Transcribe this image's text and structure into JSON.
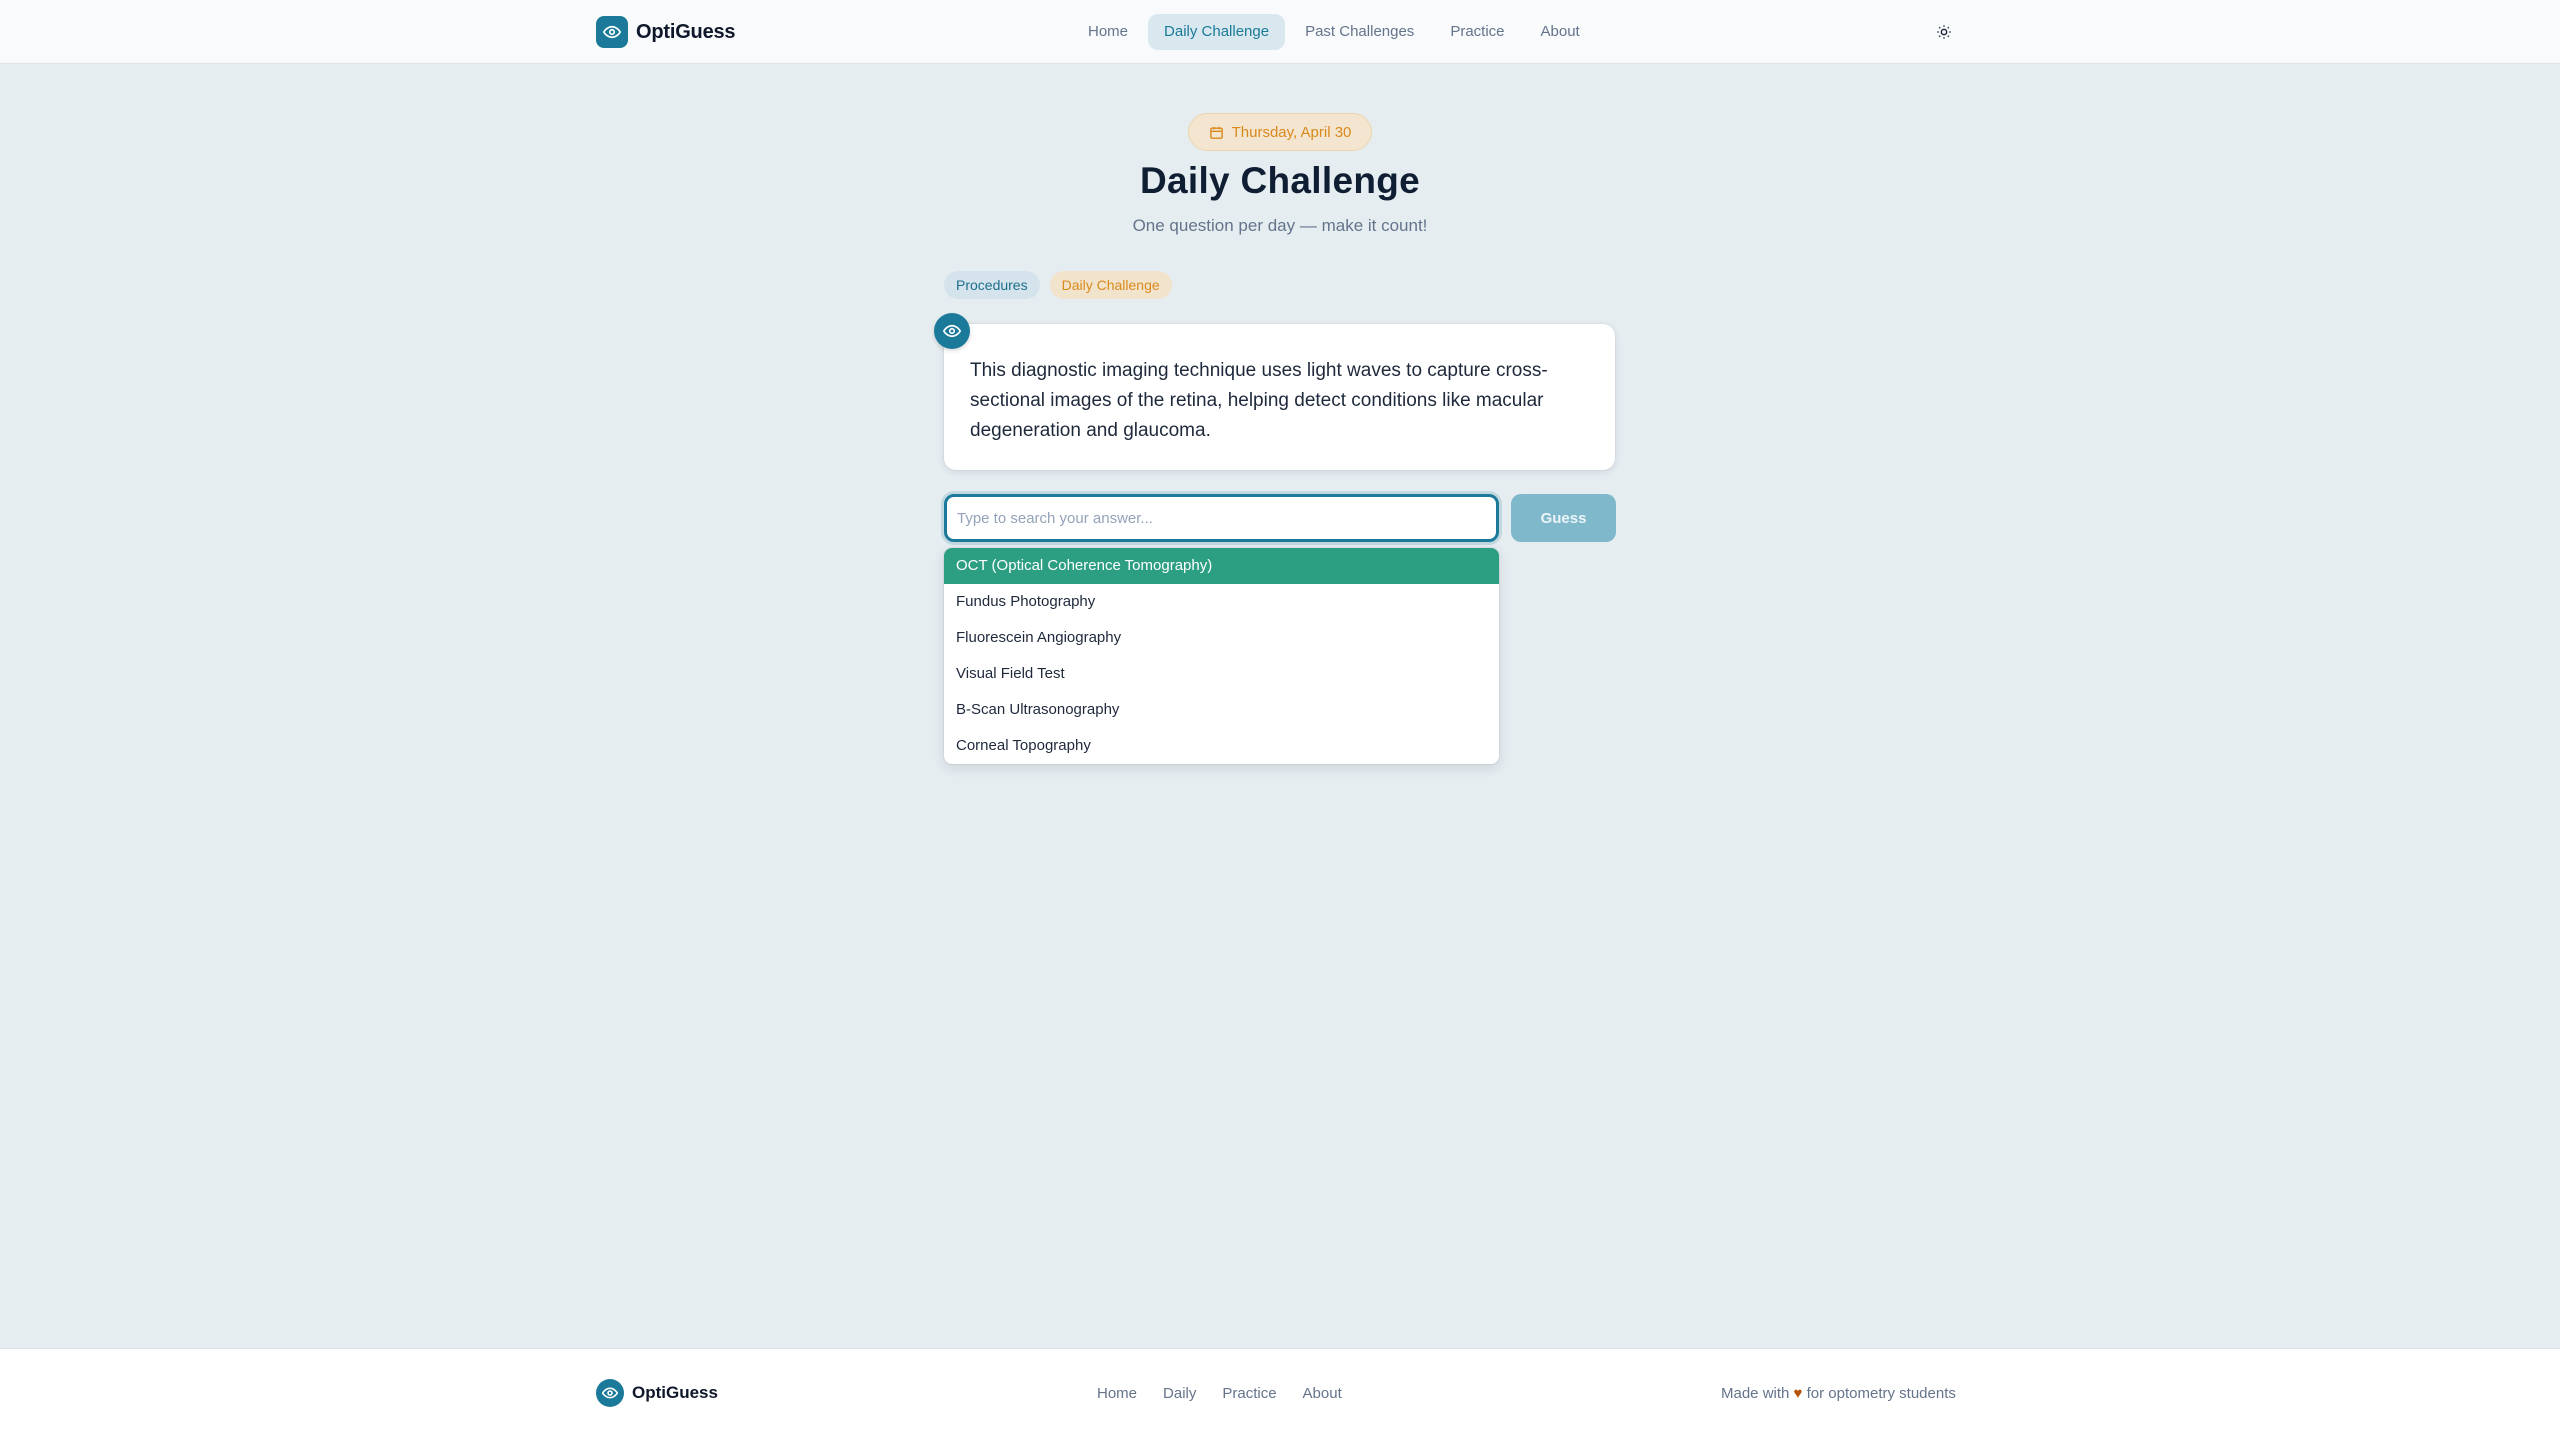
{
  "header": {
    "brand": "OptiGuess",
    "nav": [
      {
        "label": "Home"
      },
      {
        "label": "Daily Challenge",
        "active": true
      },
      {
        "label": "Past Challenges"
      },
      {
        "label": "Practice"
      },
      {
        "label": "About"
      }
    ],
    "theme_toggle_icon": "sun-icon"
  },
  "challenge": {
    "date": "Thursday, April 30",
    "title": "Daily Challenge",
    "subtitle": "One question per day — make it count!",
    "tags": [
      "Procedures",
      "Daily Challenge"
    ],
    "question": "This diagnostic imaging technique uses light waves to capture cross-sectional images of the retina, helping detect conditions like macular degeneration and glaucoma.",
    "input_value": "",
    "input_placeholder": "Type to search your answer...",
    "guess_label": "Guess",
    "options": [
      "OCT (Optical Coherence Tomography)",
      "Fundus Photography",
      "Fluorescein Angiography",
      "Visual Field Test",
      "B-Scan Ultrasonography",
      "Corneal Topography"
    ],
    "selected_option": "OCT (Optical Coherence Tomography)"
  },
  "footer": {
    "brand": "OptiGuess",
    "links": [
      "Home",
      "Daily",
      "Practice",
      "About"
    ],
    "credit_prefix": "Made with",
    "credit_heart": "♥",
    "credit_suffix": "for optometry students"
  },
  "colors": {
    "primary": "#1b7a99",
    "accent": "#d98a1c",
    "selected": "#2c9e82",
    "background": "#e6edf1"
  }
}
